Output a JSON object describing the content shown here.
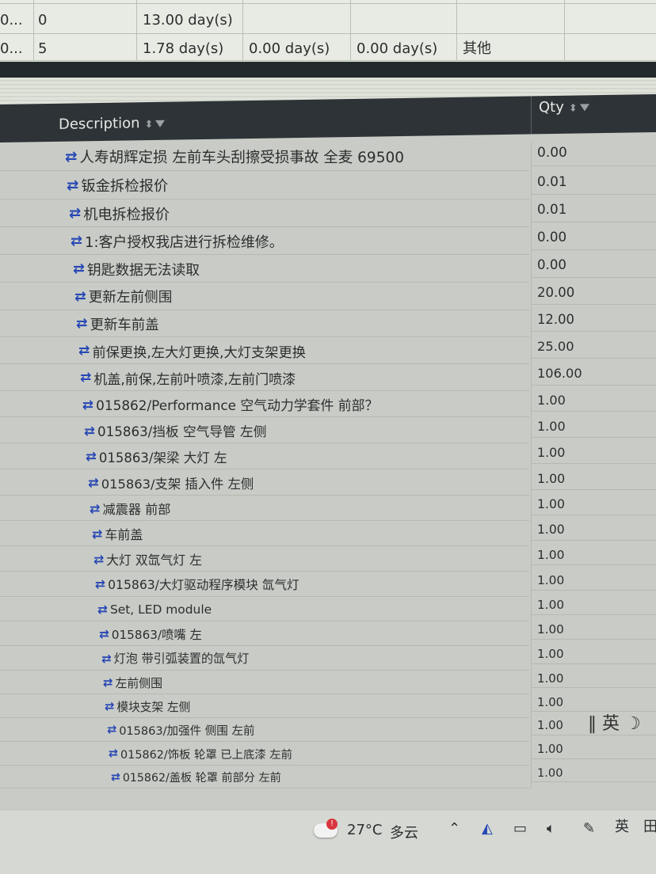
{
  "top_table": {
    "rows": [
      {
        "c1": "0...",
        "c2": "0",
        "c3": "13.00 day(s)",
        "c4": "",
        "c5": "",
        "c6": ""
      },
      {
        "c1": "0...",
        "c2": "5",
        "c3": "1.78 day(s)",
        "c4": "0.00 day(s)",
        "c5": "0.00 day(s)",
        "c6": "其他"
      }
    ]
  },
  "grid": {
    "columns": {
      "description": "Description",
      "qty": "Qty"
    },
    "rows": [
      {
        "description": "人寿胡辉定损 左前车头刮擦受损事故 全麦 69500",
        "qty": "0.00"
      },
      {
        "description": "钣金拆检报价",
        "qty": "0.01"
      },
      {
        "description": "机电拆检报价",
        "qty": "0.01"
      },
      {
        "description": "1:客户授权我店进行拆检维修。",
        "qty": "0.00"
      },
      {
        "description": "钥匙数据无法读取",
        "qty": "0.00"
      },
      {
        "description": "更新左前侧围",
        "qty": "20.00"
      },
      {
        "description": "更新车前盖",
        "qty": "12.00"
      },
      {
        "description": "前保更换,左大灯更换,大灯支架更换",
        "qty": "25.00"
      },
      {
        "description": "机盖,前保,左前叶喷漆,左前门喷漆",
        "qty": "106.00"
      },
      {
        "description": "015862/Performance 空气动力学套件 前部？",
        "qty": "1.00"
      },
      {
        "description": "015863/挡板 空气导管 左侧",
        "qty": "1.00"
      },
      {
        "description": "015863/架梁 大灯 左",
        "qty": "1.00"
      },
      {
        "description": "015863/支架 插入件 左侧",
        "qty": "1.00"
      },
      {
        "description": "减震器 前部",
        "qty": "1.00"
      },
      {
        "description": "车前盖",
        "qty": "1.00"
      },
      {
        "description": "大灯 双氙气灯 左",
        "qty": "1.00"
      },
      {
        "description": "015863/大灯驱动程序模块 氙气灯",
        "qty": "1.00"
      },
      {
        "description": "Set, LED module",
        "qty": "1.00"
      },
      {
        "description": "015863/喷嘴 左",
        "qty": "1.00"
      },
      {
        "description": "灯泡 带引弧装置的氙气灯",
        "qty": "1.00"
      },
      {
        "description": "左前侧围",
        "qty": "1.00"
      },
      {
        "description": "模块支架 左侧",
        "qty": "1.00"
      },
      {
        "description": "015863/加强件 侧围 左前",
        "qty": "1.00"
      },
      {
        "description": "015862/饰板 轮罩 已上底漆 左前",
        "qty": "1.00"
      },
      {
        "description": "015862/盖板 轮罩 前部分 左前",
        "qty": "1.00"
      }
    ],
    "row_icon": "swap-arrows-icon",
    "accent_color": "#2747b5"
  },
  "tray_popup": {
    "ime": "英"
  },
  "taskbar": {
    "weather_badge": "!",
    "temperature": "27°C",
    "weather": "多云",
    "ime": "英",
    "ime_extra": "田"
  }
}
